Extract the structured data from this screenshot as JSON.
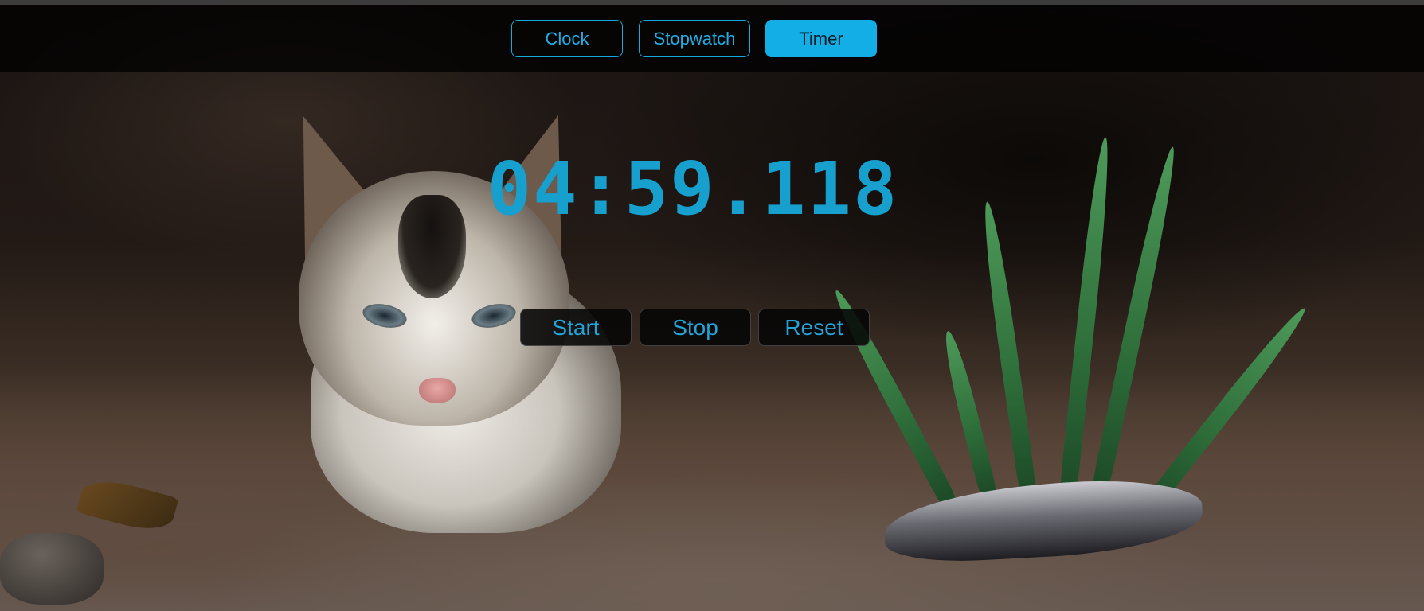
{
  "tabs": [
    {
      "label": "Clock",
      "active": false
    },
    {
      "label": "Stopwatch",
      "active": false
    },
    {
      "label": "Timer",
      "active": true
    }
  ],
  "timer": {
    "display": "04:59.118"
  },
  "controls": {
    "start_label": "Start",
    "stop_label": "Stop",
    "reset_label": "Reset"
  },
  "colors": {
    "accent": "#13aee6",
    "timer_text": "#179fce",
    "bar_background": "#000000"
  },
  "background": {
    "image": "kitten-photo"
  }
}
